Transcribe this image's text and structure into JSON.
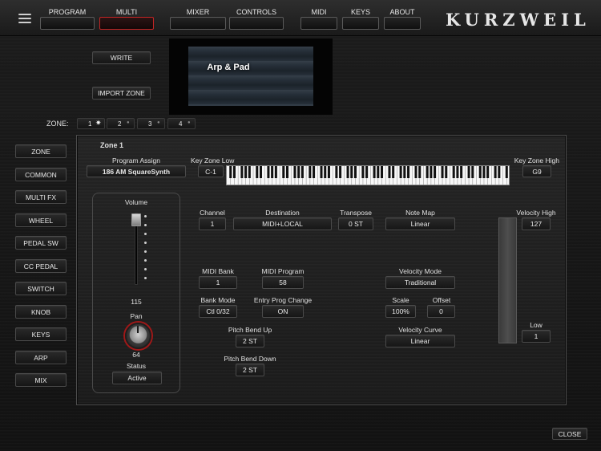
{
  "nav": {
    "tabs": [
      {
        "label": "PROGRAM"
      },
      {
        "label": "MULTI"
      },
      {
        "label": "MIXER"
      },
      {
        "label": "CONTROLS"
      },
      {
        "label": "MIDI"
      },
      {
        "label": "KEYS"
      },
      {
        "label": "ABOUT"
      }
    ],
    "active": "MULTI",
    "brand": "KURZWEIL"
  },
  "actions": {
    "write": "WRITE",
    "import_zone": "IMPORT ZONE"
  },
  "display": {
    "program_name": "Arp & Pad"
  },
  "zone_selector": {
    "label": "ZONE:",
    "zones": [
      "1",
      "2",
      "3",
      "4"
    ],
    "selected": "1"
  },
  "sidebar": {
    "items": [
      "ZONE",
      "COMMON",
      "MULTI FX",
      "WHEEL",
      "PEDAL SW",
      "CC PEDAL",
      "SWITCH",
      "KNOB",
      "KEYS",
      "ARP",
      "MIX"
    ]
  },
  "panel": {
    "title": "Zone 1",
    "program_assign": {
      "label": "Program Assign",
      "value": "186 AM SquareSynth"
    },
    "key_zone_low": {
      "label": "Key Zone Low",
      "value": "C-1"
    },
    "key_zone_high": {
      "label": "Key Zone High",
      "value": "G9"
    },
    "volume": {
      "label": "Volume",
      "value": "115"
    },
    "pan": {
      "label": "Pan",
      "value": "64"
    },
    "status": {
      "label": "Status",
      "value": "Active"
    },
    "channel": {
      "label": "Channel",
      "value": "1"
    },
    "destination": {
      "label": "Destination",
      "value": "MIDI+LOCAL"
    },
    "transpose": {
      "label": "Transpose",
      "value": "0 ST"
    },
    "note_map": {
      "label": "Note Map",
      "value": "Linear"
    },
    "velocity_high": {
      "label": "Velocity High",
      "value": "127"
    },
    "velocity_low": {
      "label": "Low",
      "value": "1"
    },
    "midi_bank": {
      "label": "MIDI Bank",
      "value": "1"
    },
    "midi_program": {
      "label": "MIDI Program",
      "value": "58"
    },
    "velocity_mode": {
      "label": "Velocity Mode",
      "value": "Traditional"
    },
    "bank_mode": {
      "label": "Bank Mode",
      "value": "Ctl 0/32"
    },
    "entry_prog_change": {
      "label": "Entry Prog Change",
      "value": "ON"
    },
    "scale": {
      "label": "Scale",
      "value": "100%"
    },
    "offset": {
      "label": "Offset",
      "value": "0"
    },
    "pitch_bend_up": {
      "label": "Pitch Bend Up",
      "value": "2 ST"
    },
    "pitch_bend_down": {
      "label": "Pitch Bend Down",
      "value": "2 ST"
    },
    "velocity_curve": {
      "label": "Velocity Curve",
      "value": "Linear"
    }
  },
  "footer": {
    "close": "CLOSE"
  },
  "colors": {
    "accent": "#c22525",
    "panel": "#1f1f1f",
    "text": "#e4e4e4"
  },
  "icons": {
    "menu": "hamburger-menu-icon"
  }
}
